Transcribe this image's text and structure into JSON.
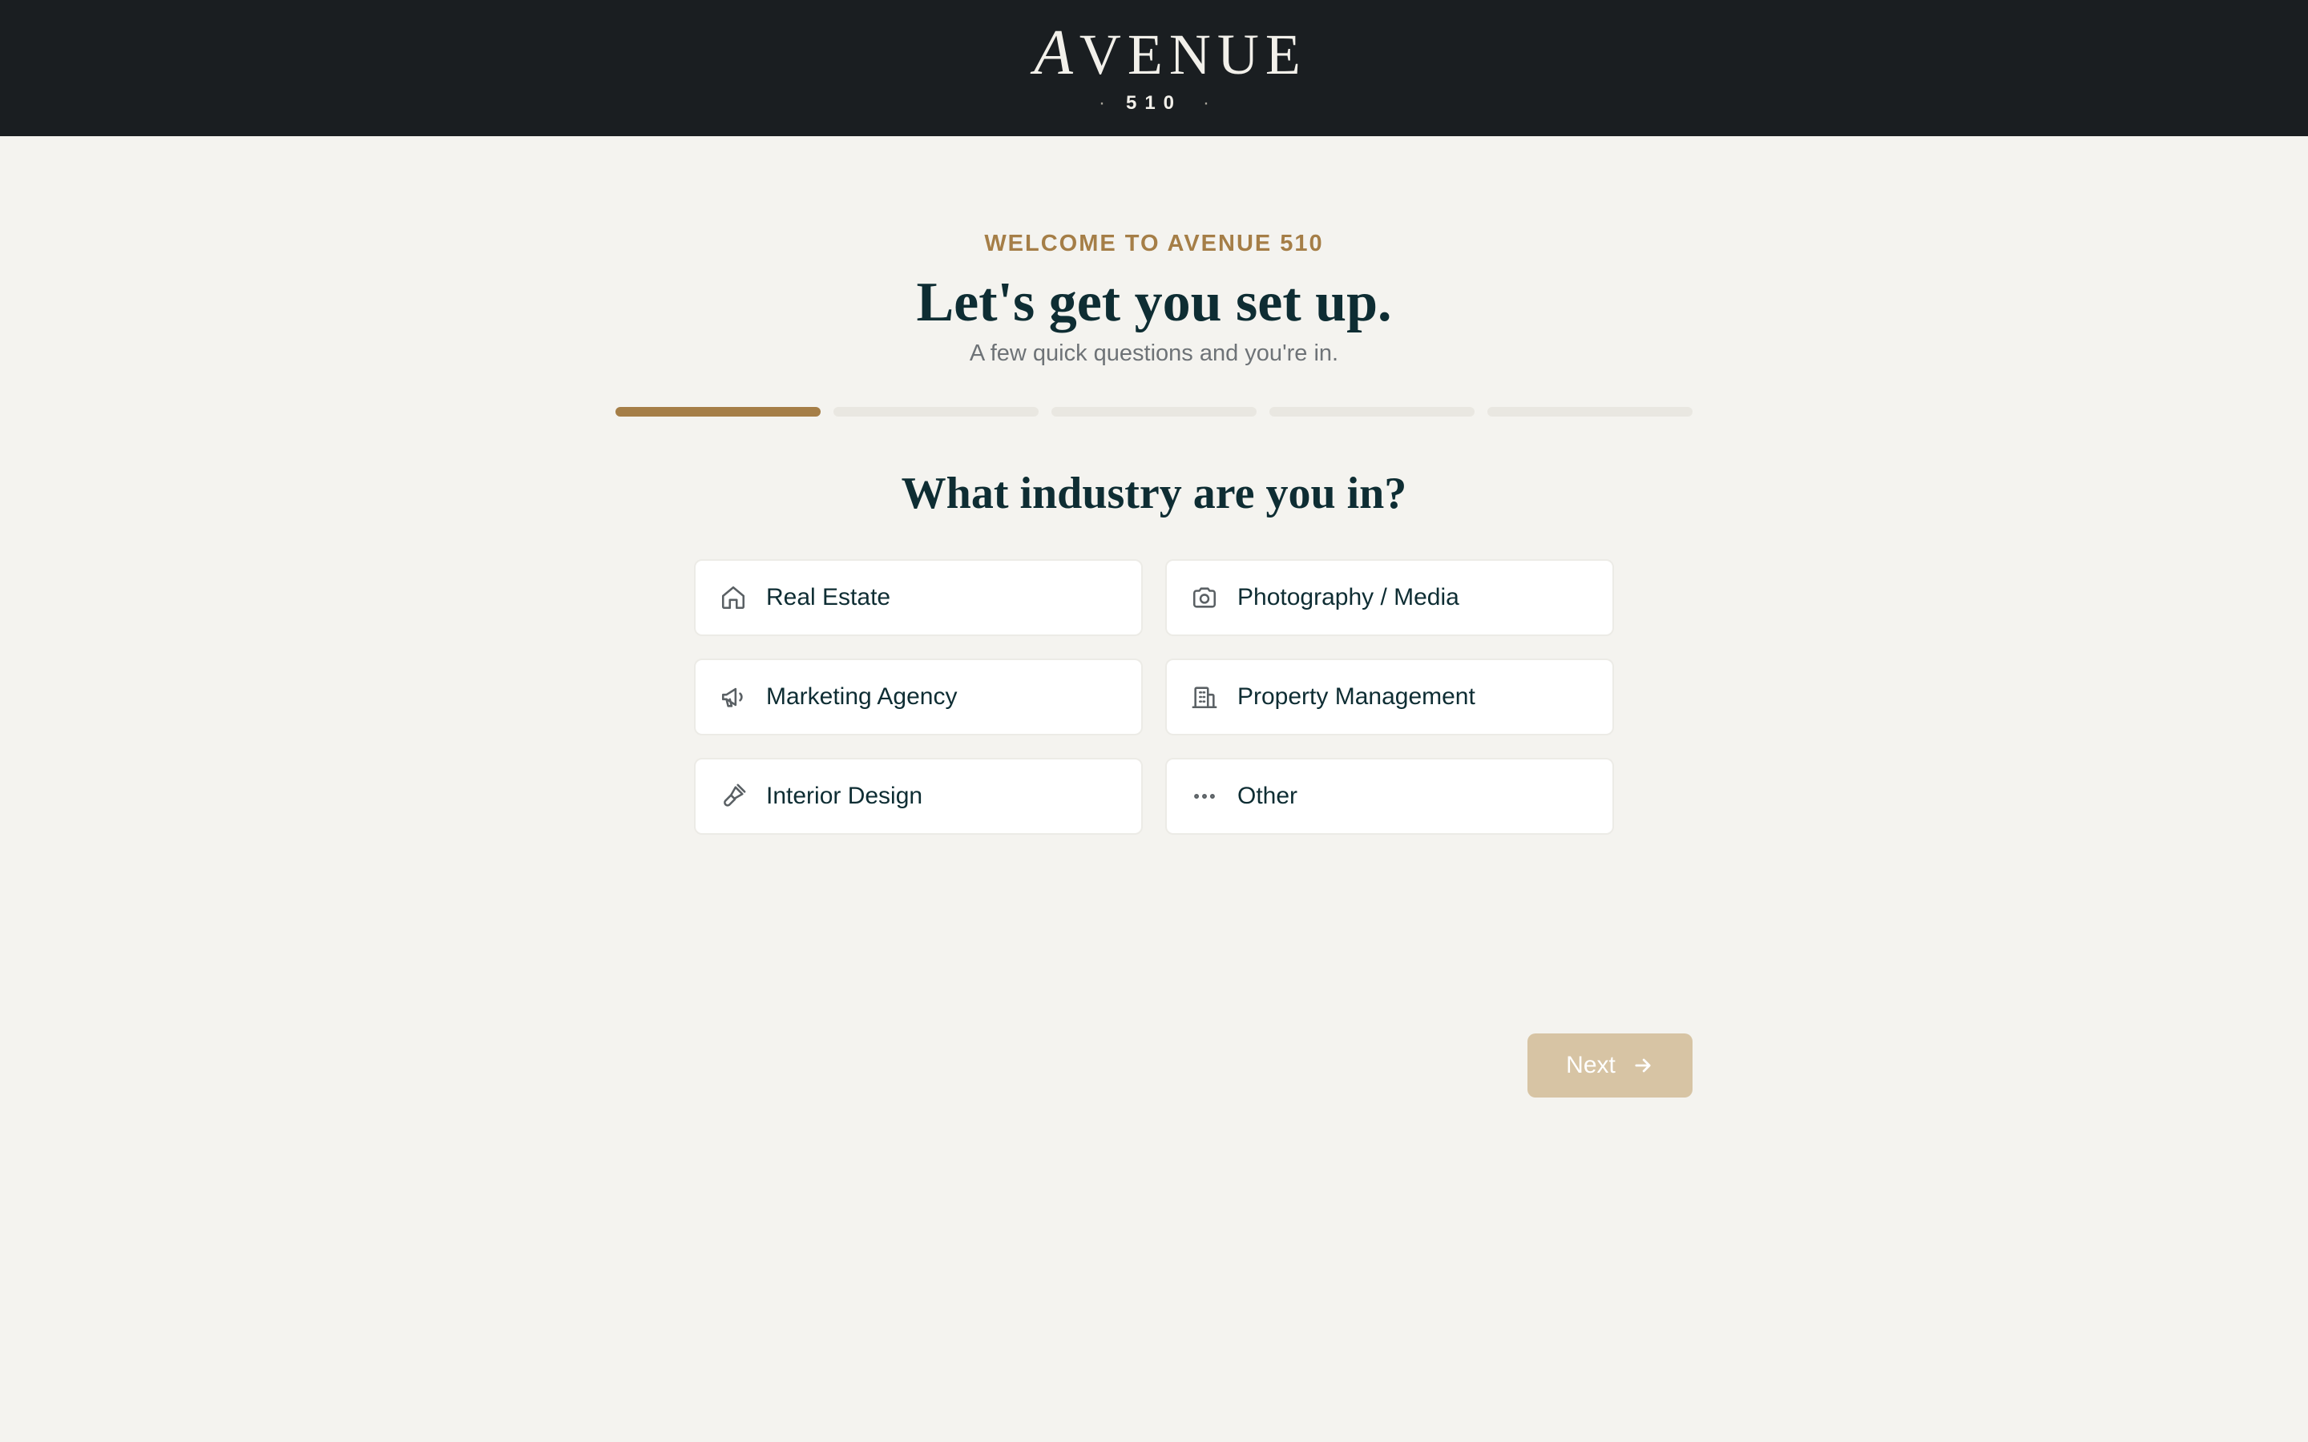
{
  "header": {
    "logo_word_first": "A",
    "logo_word_rest": "VENUE",
    "logo_number": "510",
    "logo_separator": "·",
    "background_color": "#1a1e21"
  },
  "intro": {
    "eyebrow": "WELCOME TO AVENUE 510",
    "title": "Let's get you set up.",
    "subtitle": "A few quick questions and you're in."
  },
  "progress": {
    "current_step": 1,
    "total_steps": 5,
    "active_color": "#a57e47"
  },
  "question": {
    "text": "What industry are you in?"
  },
  "options": [
    {
      "label": "Real Estate",
      "icon": "home-icon"
    },
    {
      "label": "Photography / Media",
      "icon": "camera-icon"
    },
    {
      "label": "Marketing Agency",
      "icon": "megaphone-icon"
    },
    {
      "label": "Property Management",
      "icon": "building-icon"
    },
    {
      "label": "Interior Design",
      "icon": "paintbrush-icon"
    },
    {
      "label": "Other",
      "icon": "more-horizontal-icon"
    }
  ],
  "footer": {
    "next_label": "Next",
    "next_icon": "arrow-right-icon",
    "next_enabled": false
  },
  "colors": {
    "accent": "#a57e47",
    "page_background": "#f4f3ef",
    "heading": "#0e2d33",
    "next_disabled": "#d7c4a4"
  }
}
